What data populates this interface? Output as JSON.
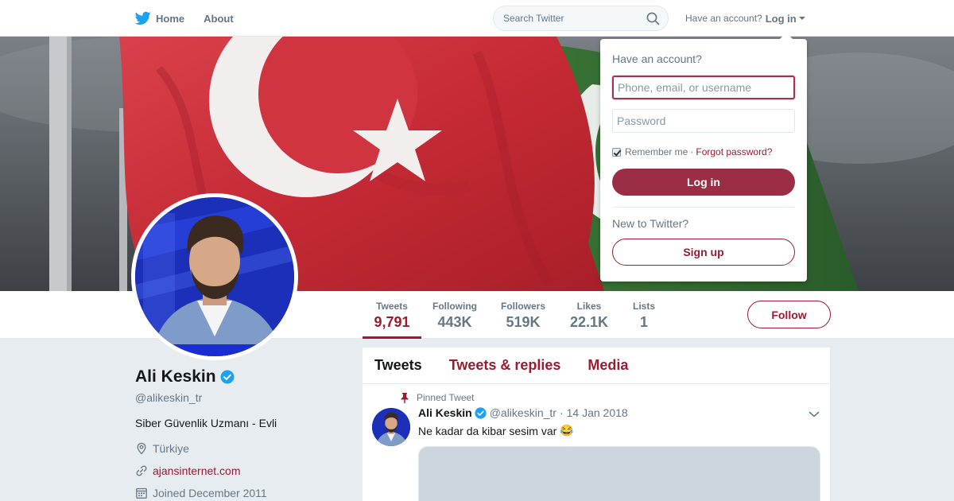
{
  "nav": {
    "home_label": "Home",
    "about_label": "About",
    "search_placeholder": "Search Twitter",
    "have_account": "Have an account?",
    "login_label": "Log in"
  },
  "profile": {
    "name": "Ali Keskin",
    "handle": "@alikeskin_tr",
    "bio": "Siber Güvenlik Uzmanı - Evli",
    "location": "Türkiye",
    "website": "ajansinternet.com",
    "joined": "Joined December 2011",
    "verified": true
  },
  "stats": [
    {
      "label": "Tweets",
      "value": "9,791",
      "active": true
    },
    {
      "label": "Following",
      "value": "443K"
    },
    {
      "label": "Followers",
      "value": "519K"
    },
    {
      "label": "Likes",
      "value": "22.1K"
    },
    {
      "label": "Lists",
      "value": "1"
    }
  ],
  "follow_label": "Follow",
  "timeline": {
    "tabs": [
      "Tweets",
      "Tweets & replies",
      "Media"
    ],
    "pinned_label": "Pinned Tweet",
    "tweet": {
      "name": "Ali Keskin",
      "handle": "@alikeskin_tr",
      "separator": "·",
      "date": "14 Jan 2018",
      "text": "Ne kadar da kibar sesim var",
      "emoji": "😂"
    }
  },
  "login_dropdown": {
    "title": "Have an account?",
    "username_placeholder": "Phone, email, or username",
    "password_placeholder": "Password",
    "remember_label": "Remember me",
    "separator": "·",
    "forgot_label": "Forgot password?",
    "login_button": "Log in",
    "new_label": "New to Twitter?",
    "signup_button": "Sign up",
    "remember_checked": true
  },
  "colors": {
    "accent": "#9b1b30",
    "twitter_blue": "#1da1f2",
    "background": "#e6ecf0"
  },
  "icons": [
    "twitter-bird-icon",
    "search-icon",
    "verified-badge-icon",
    "location-pin-icon",
    "link-icon",
    "calendar-icon",
    "pin-icon",
    "chevron-down-icon"
  ]
}
